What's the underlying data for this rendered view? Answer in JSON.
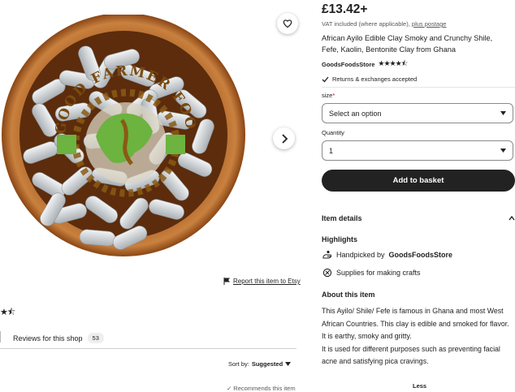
{
  "listing": {
    "price": "£13.42+",
    "vat_text": "VAT included (where applicable),",
    "vat_link": "plus postage",
    "title": "African Ayilo Edible Clay Smoky and Crunchy Shile, Fefe, Kaolin, Bentonite Clay from Ghana",
    "shop_name": "GoodsFoodsStore",
    "rating": 4.5,
    "rating_stars": "★★★★⯪",
    "returns": "Returns & exchanges accepted"
  },
  "photo": {
    "logo_text": "GOOD FARMER FOODS",
    "colors": {
      "bowl": "#b8692a",
      "bowl_dark": "#7a3c12",
      "clay": "#d9dde0",
      "globe_green": "#6cb33f",
      "seal": "#8a5a14"
    }
  },
  "options": {
    "size_label": "size",
    "size_required_mark": "*",
    "size_value": "Select an option",
    "quantity_label": "Quantity",
    "quantity_value": "1",
    "add_to_basket": "Add to basket"
  },
  "details": {
    "item_details": "Item details",
    "highlights": "Highlights",
    "handpicked_prefix": "Handpicked by",
    "handpicked_shop": "GoodsFoodsStore",
    "supplies": "Supplies for making crafts",
    "about_heading": "About this item",
    "about_paragraphs": [
      "This Ayilo/ Shile/ Fefe is famous in Ghana and most West African Countries. This clay is edible and smoked for flavor.",
      "It is earthy, smoky and gritty.",
      "It is used for different purposes such as preventing facial acne and satisfying pica cravings."
    ],
    "less": "Less"
  },
  "left_panel": {
    "report": "Report this item to Etsy",
    "rating_partial": "★⯪",
    "reviews_tab": "Reviews for this shop",
    "reviews_count": "53",
    "sort_by_label": "Sort by:",
    "sort_by_value": "Suggested",
    "recommends": "Recommends this item"
  }
}
